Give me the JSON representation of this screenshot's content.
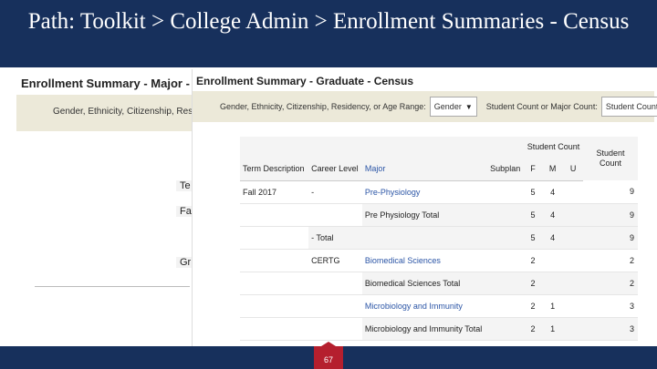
{
  "slide": {
    "title": "Path: Toolkit > College Admin > Enrollment Summaries - Census",
    "page_number": "67",
    "colors": {
      "navy": "#17305c",
      "badge_red": "#b51f2e",
      "filter_bar": "#ece9d9",
      "link_blue": "#2b55a6"
    }
  },
  "left_report": {
    "title": "Enrollment Summary - Major -",
    "filter_text": "Gender, Ethnicity, Citizenship, Resid",
    "fragments": [
      "Te",
      "Fa",
      "Gr"
    ]
  },
  "graduate_report": {
    "title": "Enrollment Summary - Graduate - Census",
    "filter_label": "Gender, Ethnicity, Citizenship, Residency, or Age Range:",
    "filter_value": "Gender",
    "count_label": "Student Count or Major Count:",
    "count_value": "Student Count",
    "table": {
      "group_header": "Student Count",
      "columns": [
        "Term Description",
        "Career Level",
        "Major",
        "Subplan",
        "F",
        "M",
        "U",
        "Student Count"
      ],
      "rows": [
        {
          "term": "Fall 2017",
          "career": "-",
          "major": "Pre-Physiology",
          "subplan": "",
          "f": "5",
          "m": "4",
          "u": "",
          "count": "9"
        },
        {
          "term": "",
          "career": "",
          "major": "Pre Physiology Total",
          "subplan": "",
          "f": "5",
          "m": "4",
          "u": "",
          "count": "9"
        },
        {
          "term": "",
          "career": "- Total",
          "major": "",
          "subplan": "",
          "f": "5",
          "m": "4",
          "u": "",
          "count": "9"
        },
        {
          "term": "",
          "career": "CERTG",
          "major": "Biomedical Sciences",
          "subplan": "",
          "f": "2",
          "m": "",
          "u": "",
          "count": "2"
        },
        {
          "term": "",
          "career": "",
          "major": "Biomedical Sciences Total",
          "subplan": "",
          "f": "2",
          "m": "",
          "u": "",
          "count": "2"
        },
        {
          "term": "",
          "career": "",
          "major": "Microbiology and Immunity",
          "subplan": "",
          "f": "2",
          "m": "1",
          "u": "",
          "count": "3"
        },
        {
          "term": "",
          "career": "",
          "major": "Microbiology and Immunity Total",
          "subplan": "",
          "f": "2",
          "m": "1",
          "u": "",
          "count": "3"
        }
      ]
    }
  }
}
